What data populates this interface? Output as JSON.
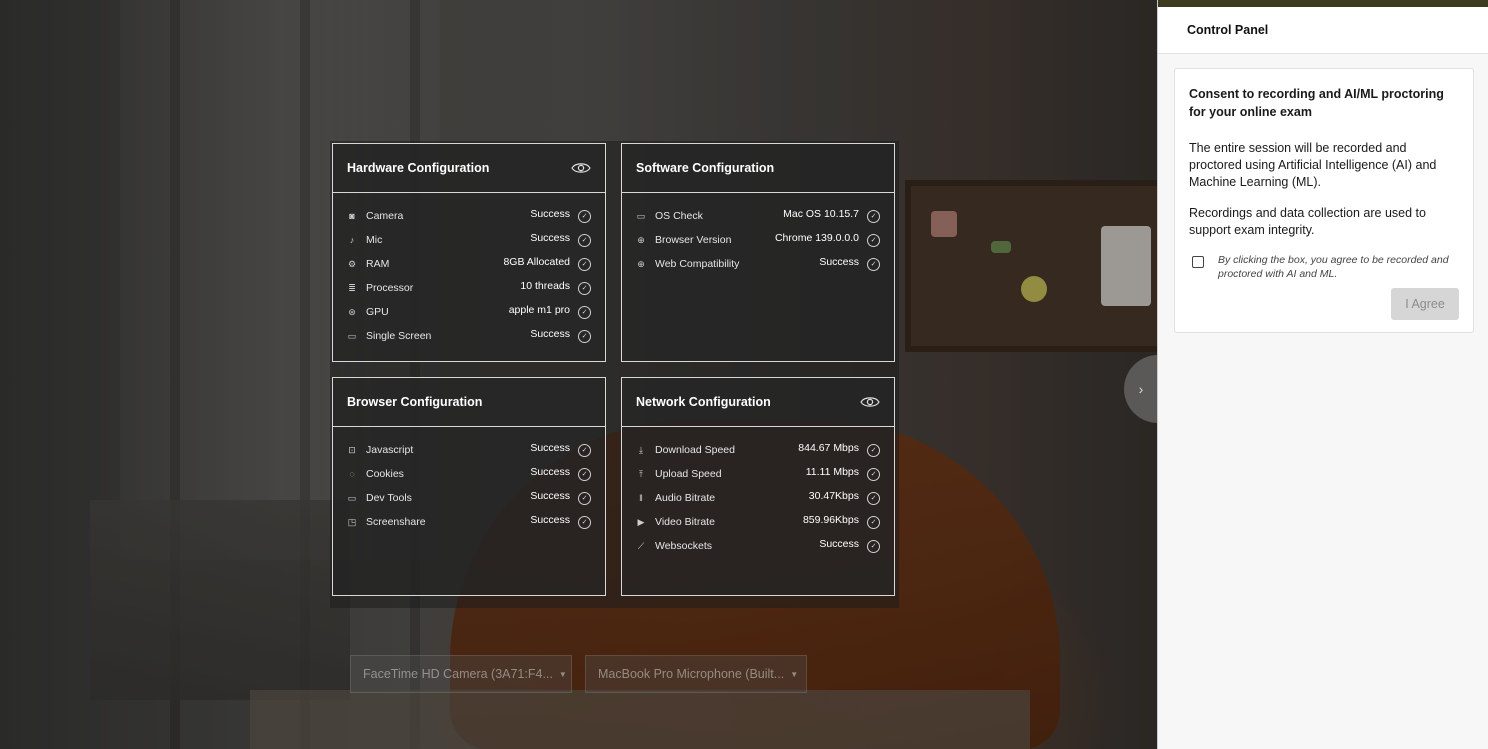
{
  "hardware": {
    "title": "Hardware Configuration",
    "rows": [
      {
        "label": "Camera",
        "value": "Success",
        "icon": "camera-icon"
      },
      {
        "label": "Mic",
        "value": "Success",
        "icon": "mic-icon"
      },
      {
        "label": "RAM",
        "value": "8GB Allocated",
        "icon": "ram-icon"
      },
      {
        "label": "Processor",
        "value": "10 threads",
        "icon": "processor-icon"
      },
      {
        "label": "GPU",
        "value": "apple m1 pro",
        "icon": "gpu-icon"
      },
      {
        "label": "Single Screen",
        "value": "Success",
        "icon": "monitor-icon"
      }
    ]
  },
  "software": {
    "title": "Software Configuration",
    "rows": [
      {
        "label": "OS Check",
        "value": "Mac OS 10.15.7",
        "icon": "monitor-icon"
      },
      {
        "label": "Browser Version",
        "value": "Chrome 139.0.0.0",
        "icon": "globe-icon"
      },
      {
        "label": "Web Compatibility",
        "value": "Success",
        "icon": "globe-icon"
      }
    ]
  },
  "browser": {
    "title": "Browser Configuration",
    "rows": [
      {
        "label": "Javascript",
        "value": "Success",
        "icon": "code-icon"
      },
      {
        "label": "Cookies",
        "value": "Success",
        "icon": "cookie-icon"
      },
      {
        "label": "Dev Tools",
        "value": "Success",
        "icon": "devtools-icon"
      },
      {
        "label": "Screenshare",
        "value": "Success",
        "icon": "screenshare-icon"
      }
    ]
  },
  "network": {
    "title": "Network Configuration",
    "rows": [
      {
        "label": "Download Speed",
        "value": "844.67 Mbps",
        "icon": "download-icon"
      },
      {
        "label": "Upload Speed",
        "value": "11.11 Mbps",
        "icon": "upload-icon"
      },
      {
        "label": "Audio Bitrate",
        "value": "30.47Kbps",
        "icon": "audio-icon"
      },
      {
        "label": "Video Bitrate",
        "value": "859.96Kbps",
        "icon": "video-icon"
      },
      {
        "label": "Websockets",
        "value": "Success",
        "icon": "plug-icon"
      }
    ]
  },
  "devices": {
    "camera": "FaceTime HD Camera (3A71:F4...",
    "microphone": "MacBook Pro Microphone (Built..."
  },
  "panel": {
    "title": "Control Panel",
    "consent_heading": "Consent to recording and AI/ML proctoring for your online exam",
    "para1": "The entire session will be recorded and proctored using Artificial Intelligence (AI) and Machine Learning (ML).",
    "para2": "Recordings and data collection are used to support exam integrity.",
    "checkbox_text": "By clicking the box, you agree to be recorded and proctored with AI and ML.",
    "agree_label": "I Agree"
  },
  "colors": {
    "panel_topbar": "#3c3b22",
    "disabled_button": "#d6d6d6"
  }
}
